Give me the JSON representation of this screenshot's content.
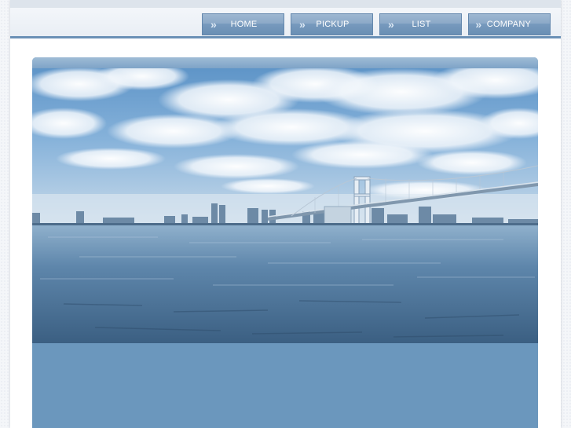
{
  "nav": {
    "items": [
      {
        "label": "HOME",
        "icon": "double-chevron-right-icon"
      },
      {
        "label": "PICKUP",
        "icon": "double-chevron-right-icon"
      },
      {
        "label": "LIST",
        "icon": "double-chevron-right-icon"
      },
      {
        "label": "COMPANY",
        "icon": "double-chevron-right-icon"
      }
    ],
    "chevron_glyph": "»"
  },
  "colors": {
    "nav_bg": "#7598bc",
    "header_rule": "#6b91b6",
    "content_bg": "#6b97bd"
  },
  "hero": {
    "subject": "bay-bridge-skyline-photo"
  }
}
